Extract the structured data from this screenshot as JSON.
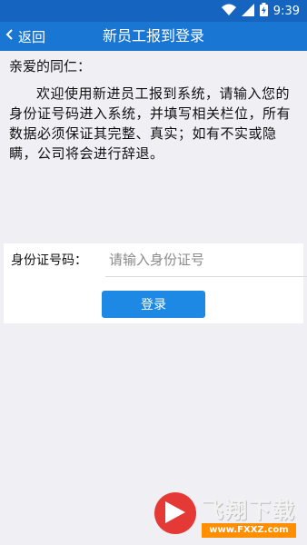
{
  "status_bar": {
    "time": "9:39",
    "icons": [
      "wifi-icon",
      "signal-icon",
      "battery-charging-icon"
    ]
  },
  "toolbar": {
    "back_label": "返回",
    "title": "新员工报到登录",
    "color": "#1976d2"
  },
  "notice": {
    "greeting": "亲爱的同仁：",
    "body": "欢迎使用新进员工报到系统，请输入您的身份证号码进入系统，并填写相关栏位，所有数据必须保证其完整、真实；如有不实或隐瞒，公司将会进行辞退。"
  },
  "form": {
    "id_label": "身份证号码：",
    "id_placeholder": "请输入身份证号",
    "id_value": "",
    "login_label": "登录",
    "button_color": "#1e88e5"
  },
  "watermark": {
    "name": "飞翔下载",
    "url": "www.FXXZ.com"
  }
}
